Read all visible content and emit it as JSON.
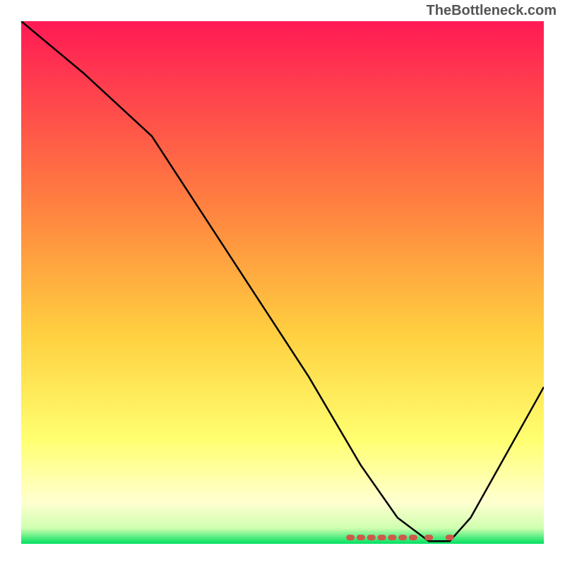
{
  "watermark": "TheBottleneck.com",
  "chart_data": {
    "type": "line",
    "title": "",
    "xlabel": "",
    "ylabel": "",
    "xlim": [
      0,
      100
    ],
    "ylim": [
      0,
      100
    ],
    "background_gradient": {
      "stops": [
        {
          "offset": 0.0,
          "color": "#ff1a55"
        },
        {
          "offset": 0.35,
          "color": "#ff8040"
        },
        {
          "offset": 0.6,
          "color": "#ffd040"
        },
        {
          "offset": 0.8,
          "color": "#ffff70"
        },
        {
          "offset": 0.92,
          "color": "#ffffd0"
        },
        {
          "offset": 0.97,
          "color": "#d0ffb0"
        },
        {
          "offset": 1.0,
          "color": "#00e060"
        }
      ]
    },
    "series": [
      {
        "name": "bottleneck-curve",
        "color": "#000000",
        "x": [
          0,
          12,
          25,
          40,
          55,
          65,
          72,
          78,
          82,
          86,
          100
        ],
        "y": [
          100,
          90,
          78,
          55,
          32,
          15,
          5,
          0.5,
          0.5,
          5,
          30
        ]
      }
    ],
    "markers": {
      "name": "optimal-range",
      "color": "#cc5a4a",
      "x": [
        63,
        65,
        67,
        69,
        71,
        73,
        75,
        78,
        82
      ],
      "y": [
        1.2,
        1.2,
        1.2,
        1.2,
        1.2,
        1.2,
        1.2,
        1.2,
        1.2
      ]
    }
  }
}
